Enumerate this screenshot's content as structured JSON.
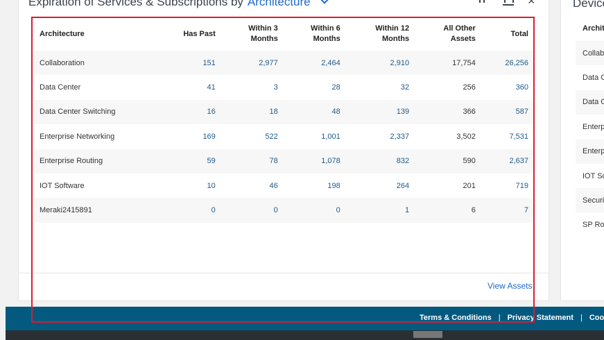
{
  "main_card": {
    "title": "Expiration of Services & Subscriptions by",
    "group_by": "Architecture",
    "icons": [
      "export-icon",
      "columns-icon",
      "close-icon"
    ],
    "view_assets": "View Assets"
  },
  "table": {
    "headers": [
      "Architecture",
      "Has Past",
      "Within 3 Months",
      "Within 6 Months",
      "Within 12 Months",
      "All Other Assets",
      "Total"
    ],
    "rows": [
      [
        "Collaboration",
        "151",
        "2,977",
        "2,464",
        "2,910",
        "17,754",
        "26,256"
      ],
      [
        "Data Center",
        "41",
        "3",
        "28",
        "32",
        "256",
        "360"
      ],
      [
        "Data Center Switching",
        "16",
        "18",
        "48",
        "139",
        "366",
        "587"
      ],
      [
        "Enterprise Networking",
        "169",
        "522",
        "1,001",
        "2,337",
        "3,502",
        "7,531"
      ],
      [
        "Enterprise Routing",
        "59",
        "78",
        "1,078",
        "832",
        "590",
        "2,637"
      ],
      [
        "IOT Software",
        "10",
        "46",
        "198",
        "264",
        "201",
        "719"
      ],
      [
        "Meraki2415891",
        "0",
        "0",
        "0",
        "1",
        "6",
        "7"
      ]
    ]
  },
  "right_card": {
    "title": "Device",
    "column_label": "Archit",
    "rows": [
      "Collab",
      "Data C",
      "Data C",
      "Enterp",
      "Enterp",
      "IOT Sc",
      "Securi",
      "SP Rou"
    ]
  },
  "footer": {
    "links": [
      "Terms & Conditions",
      "Privacy Statement",
      "Cook"
    ],
    "separator": "|"
  },
  "colors": {
    "link": "#1d69cc",
    "footer_bg": "#04597f",
    "highlight": "#e0182f"
  }
}
